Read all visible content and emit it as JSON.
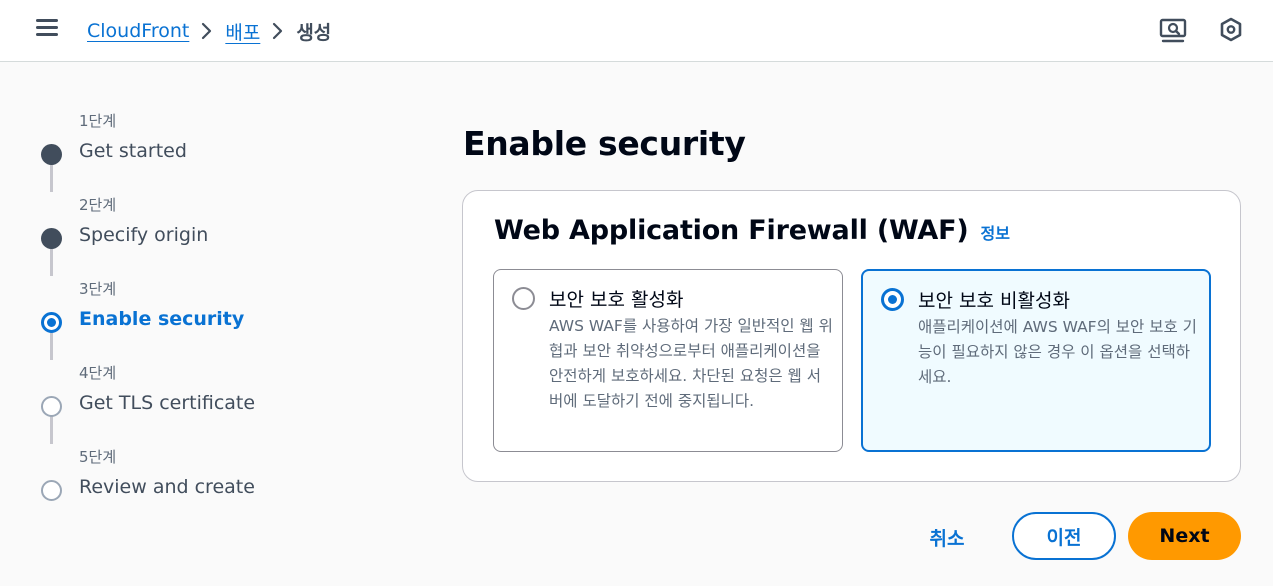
{
  "header": {
    "breadcrumbs": [
      "CloudFront",
      "배포",
      "생성"
    ],
    "icons": [
      "menu-icon",
      "chevron-right-icon",
      "screen-search-icon",
      "hexagon-settings-icon"
    ]
  },
  "steps": [
    {
      "number": "1단계",
      "label": "Get started",
      "state": "done"
    },
    {
      "number": "2단계",
      "label": "Specify origin",
      "state": "done"
    },
    {
      "number": "3단계",
      "label": "Enable security",
      "state": "current"
    },
    {
      "number": "4단계",
      "label": "Get TLS certificate",
      "state": "pending"
    },
    {
      "number": "5단계",
      "label": "Review and create",
      "state": "pending"
    }
  ],
  "main": {
    "title": "Enable security",
    "waf": {
      "title": "Web Application Firewall (WAF)",
      "info": "정보",
      "options": [
        {
          "label": "보안 보호 활성화",
          "description": "AWS WAF를 사용하여 가장 일반적인 웹 위협과 보안 취약성으로부터 애플리케이션을 안전하게 보호하세요. 차단된 요청은 웹 서버에 도달하기 전에 중지됩니다.",
          "selected": false
        },
        {
          "label": "보안 보호 비활성화",
          "description": "애플리케이션에 AWS WAF의 보안 보호 기능이 필요하지 않은 경우 이 옵션을 선택하세요.",
          "selected": true
        }
      ]
    }
  },
  "footer": {
    "cancel": "취소",
    "previous": "이전",
    "next": "Next"
  },
  "colors": {
    "accent": "#0972d3",
    "primary_button": "#ff9900",
    "selected_tile_bg": "#f0fbff"
  }
}
